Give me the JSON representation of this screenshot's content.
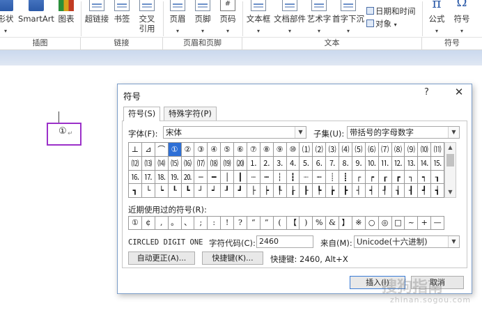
{
  "ribbon": {
    "items": [
      {
        "label": "形状",
        "x": 0
      },
      {
        "label": "SmartArt"
      },
      {
        "label": "图表"
      },
      {
        "label": "超链接"
      },
      {
        "label": "书签"
      },
      {
        "label": "交叉\n引用"
      },
      {
        "label": "页眉"
      },
      {
        "label": "页脚"
      },
      {
        "label": "页码"
      },
      {
        "label": "文本框"
      },
      {
        "label": "文档部件"
      },
      {
        "label": "艺术字"
      },
      {
        "label": "首字下沉"
      },
      {
        "label": "公式"
      },
      {
        "label": "符号"
      }
    ],
    "small": {
      "datetime": "日期和时间",
      "object": "对象"
    },
    "groups": [
      "插图",
      "链接",
      "页眉和页脚",
      "文本",
      "符号"
    ]
  },
  "document": {
    "inserted_char": "①",
    "para_mark": "↵"
  },
  "dialog": {
    "title": "符号",
    "help": "?",
    "close": "✕",
    "tabs": [
      "符号(S)",
      "特殊字符(P)"
    ],
    "font_label": "字体(F):",
    "font_value": "宋体",
    "subset_label": "子集(U):",
    "subset_value": "带括号的字母数字",
    "symbols": [
      [
        "⊥",
        "⊿",
        "⌒",
        "①",
        "②",
        "③",
        "④",
        "⑤",
        "⑥",
        "⑦",
        "⑧",
        "⑨",
        "⑩",
        "⑴",
        "⑵",
        "⑶",
        "⑷",
        "⑸",
        "⑹",
        "⑺",
        "⑻",
        "⑼",
        "⑽",
        "⑾"
      ],
      [
        "⑿",
        "⒀",
        "⒁",
        "⒂",
        "⒃",
        "⒄",
        "⒅",
        "⒆",
        "⒇",
        "⒈",
        "⒉",
        "⒊",
        "⒋",
        "⒌",
        "⒍",
        "⒎",
        "⒏",
        "⒐",
        "⒑",
        "⒒",
        "⒓",
        "⒔",
        "⒕",
        "⒖"
      ],
      [
        "⒗",
        "⒘",
        "⒙",
        "⒚",
        "⒛",
        "─",
        "━",
        "│",
        "┃",
        "┄",
        "┅",
        "┆",
        "┇",
        "┈",
        "┉",
        "┊",
        "┋",
        "┌",
        "┍",
        "┎",
        "┏",
        "┐",
        "┑",
        "┒"
      ],
      [
        "┓",
        "└",
        "┕",
        "┖",
        "┗",
        "┘",
        "┙",
        "┚",
        "┛",
        "├",
        "┝",
        "┞",
        "┟",
        "┠",
        "┡",
        "┢",
        "┣",
        "┤",
        "┥",
        "┦",
        "┧",
        "┨",
        "┩",
        "┪"
      ]
    ],
    "selected_index": 3,
    "recent_label": "近期使用过的符号(R):",
    "recent": [
      "①",
      "¢",
      ",",
      "。",
      "、",
      ";",
      ":",
      "!",
      "?",
      "“",
      "”",
      "(",
      "【",
      ")",
      "%",
      "&",
      "】",
      "※",
      "○",
      "◎",
      "□",
      "~",
      "+",
      "—"
    ],
    "char_name": "CIRCLED DIGIT ONE",
    "code_label": "字符代码(C):",
    "code_value": "2460",
    "from_label": "来自(M):",
    "from_value": "Unicode(十六进制)",
    "autocorrect_btn": "自动更正(A)...",
    "shortcut_btn": "快捷键(K)...",
    "shortcut_text": "快捷键: 2460, Alt+X",
    "insert_btn": "插入(I)",
    "cancel_btn": "取消"
  },
  "watermark": {
    "text": "搜狗指南",
    "sub": "zhinan.sogou.com"
  }
}
